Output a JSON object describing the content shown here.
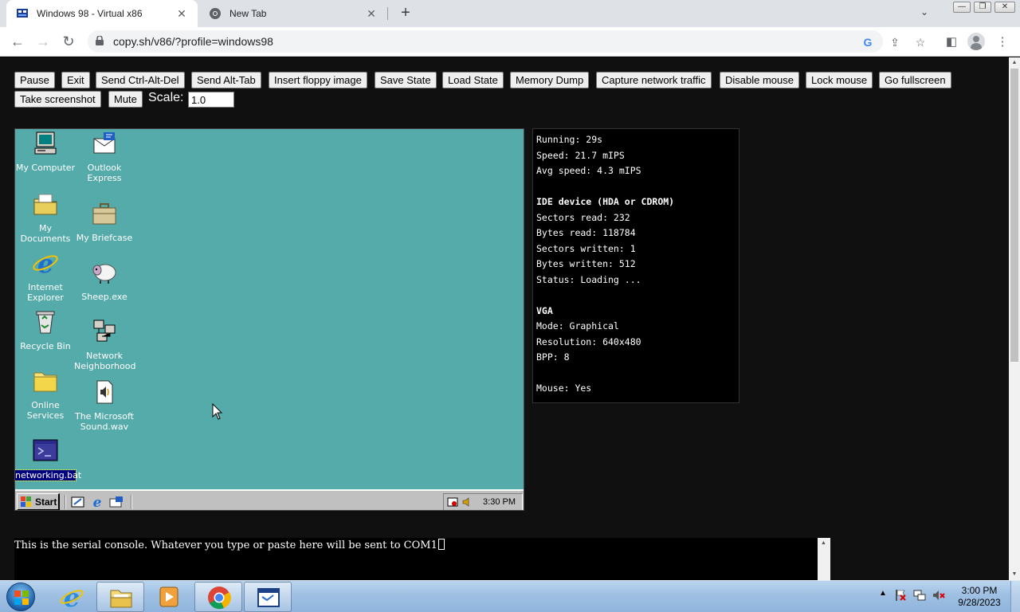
{
  "browser": {
    "tabs": [
      {
        "title": "Windows 98 - Virtual x86",
        "icon": "v86-icon",
        "active": true
      },
      {
        "title": "New Tab",
        "icon": "chrome-icon",
        "active": false
      }
    ],
    "url": "copy.sh/v86/?profile=windows98",
    "window_controls": {
      "minimize": "—",
      "maximize": "❐",
      "close": "✕"
    }
  },
  "controls": {
    "buttons": [
      "Pause",
      "Exit",
      "Send Ctrl-Alt-Del",
      "Send Alt-Tab",
      "Insert floppy image",
      "Save State",
      "Load State",
      "Memory Dump",
      "Capture network traffic",
      "Disable mouse",
      "Lock mouse",
      "Go fullscreen",
      "Take screenshot",
      "Mute"
    ],
    "scale_label": "Scale:",
    "scale_value": "1.0"
  },
  "win98": {
    "desktop_icons": [
      {
        "label": "My Computer",
        "icon": "my-computer-icon"
      },
      {
        "label": "My Documents",
        "icon": "my-documents-icon"
      },
      {
        "label": "Internet Explorer",
        "icon": "internet-explorer-icon"
      },
      {
        "label": "Recycle Bin",
        "icon": "recycle-bin-icon"
      },
      {
        "label": "Online Services",
        "icon": "folder-icon"
      },
      {
        "label": "networking.bat",
        "icon": "batch-file-icon",
        "selected": true
      },
      {
        "label": "Outlook Express",
        "icon": "outlook-express-icon"
      },
      {
        "label": "My Briefcase",
        "icon": "briefcase-icon"
      },
      {
        "label": "Sheep.exe",
        "icon": "sheep-icon"
      },
      {
        "label": "Network Neighborhood",
        "icon": "network-icon"
      },
      {
        "label": "The Microsoft Sound.wav",
        "icon": "sound-file-icon"
      }
    ],
    "taskbar": {
      "start_label": "Start",
      "clock": "3:30 PM"
    },
    "colors": {
      "desktop": "#55aaaa",
      "taskbar": "#c0c0c0"
    }
  },
  "stats": {
    "lines": [
      {
        "text": "Running: 29s"
      },
      {
        "text": "Speed: 21.7 mIPS"
      },
      {
        "text": "Avg speed: 4.3 mIPS"
      },
      {
        "text": ""
      },
      {
        "text": "IDE device (HDA or CDROM)",
        "header": true
      },
      {
        "text": "Sectors read: 232"
      },
      {
        "text": "Bytes read: 118784"
      },
      {
        "text": "Sectors written: 1"
      },
      {
        "text": "Bytes written: 512"
      },
      {
        "text": "Status: Loading ..."
      },
      {
        "text": ""
      },
      {
        "text": "VGA",
        "header": true
      },
      {
        "text": "Mode: Graphical"
      },
      {
        "text": "Resolution: 640x480"
      },
      {
        "text": "BPP: 8"
      },
      {
        "text": ""
      },
      {
        "text": "Mouse: Yes"
      }
    ]
  },
  "serial_console": {
    "text": "This is the serial console. Whatever you type or paste here will be sent to COM1"
  },
  "os_taskbar": {
    "pinned": [
      {
        "name": "internet-explorer",
        "open": false
      },
      {
        "name": "windows-explorer",
        "open": true
      },
      {
        "name": "media-player",
        "open": false
      },
      {
        "name": "google-chrome",
        "open": true
      },
      {
        "name": "virtual-machine-window",
        "open": true
      }
    ],
    "clock_time": "3:00 PM",
    "clock_date": "9/28/2023"
  }
}
